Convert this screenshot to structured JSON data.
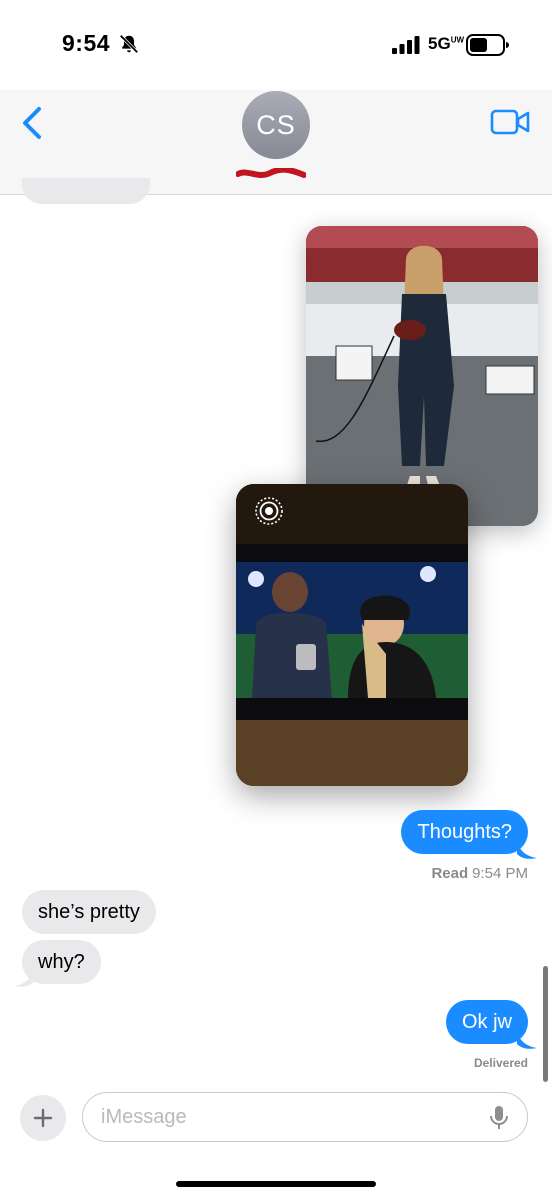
{
  "status_bar": {
    "time": "9:54",
    "network": "5G",
    "network_suffix": "UW",
    "icons": [
      "bell-slash-icon",
      "signal-bars-icon",
      "battery-icon"
    ]
  },
  "header": {
    "avatar_initials": "CS",
    "icons": [
      "back-chevron-icon",
      "video-call-icon"
    ],
    "accent_color": "#1a8cff"
  },
  "messages": {
    "sent_1": "Thoughts?",
    "read_label": "Read",
    "read_time": "9:54 PM",
    "received_1": "she’s pretty",
    "received_2": "why?",
    "sent_2": "Ok jw",
    "delivered": "Delivered"
  },
  "attachments": {
    "photo_1": "image",
    "photo_2": "live-photo"
  },
  "input_bar": {
    "placeholder": "iMessage",
    "icons": [
      "plus-icon",
      "microphone-icon"
    ]
  },
  "colors": {
    "sent_bubble": "#1a8cff",
    "received_bubble": "#e9e9eb",
    "header_bg": "#f6f6f7"
  }
}
